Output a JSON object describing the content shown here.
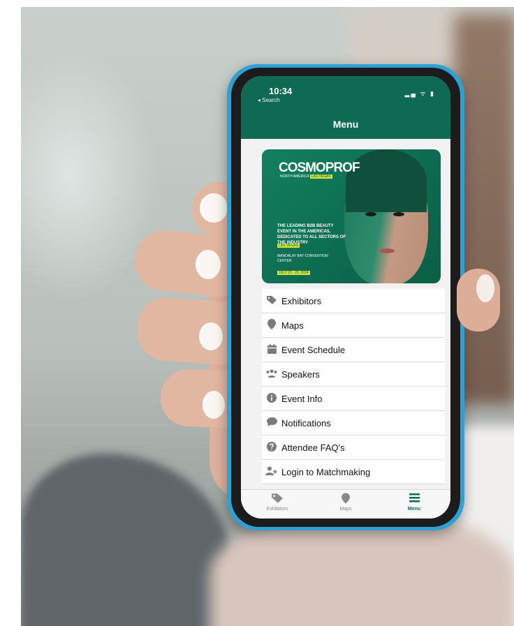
{
  "status_bar": {
    "time": "10:34",
    "back_label": "◂ Search",
    "icons": "▂▄ ᯤ ▮"
  },
  "nav": {
    "title": "Menu"
  },
  "banner": {
    "logo": "COSMOPROF",
    "subtitle": "NORTH AMERICA",
    "subtitle_highlight": "LAS VEGAS",
    "tagline": "THE LEADING B2B BEAUTY EVENT IN THE AMERICAS, DEDICATED TO ALL SECTORS OF THE INDUSTRY",
    "city": "LAS VEGAS",
    "venue": "MANDALAY BAY CONVENTION CENTER",
    "dates": "JULY 23 - 25, 2024"
  },
  "menu": {
    "items": [
      {
        "label": "Exhibitors",
        "icon": "tags-icon"
      },
      {
        "label": "Maps",
        "icon": "map-marker-icon"
      },
      {
        "label": "Event Schedule",
        "icon": "calendar-icon"
      },
      {
        "label": "Speakers",
        "icon": "users-icon"
      },
      {
        "label": "Event Info",
        "icon": "info-icon"
      },
      {
        "label": "Notifications",
        "icon": "chat-bubble-icon"
      },
      {
        "label": "Attendee FAQ's",
        "icon": "question-icon"
      },
      {
        "label": "Login to Matchmaking",
        "icon": "add-user-icon"
      }
    ]
  },
  "tabbar": {
    "tabs": [
      {
        "label": "Exhibitors",
        "icon": "tags-icon",
        "active": false
      },
      {
        "label": "Maps",
        "icon": "map-marker-icon",
        "active": false
      },
      {
        "label": "Menu",
        "icon": "list-icon",
        "active": true
      }
    ]
  },
  "colors": {
    "brand_green": "#0f6a54",
    "phone_case": "#2fa0d6",
    "accent_yellow": "#d6e33b"
  }
}
